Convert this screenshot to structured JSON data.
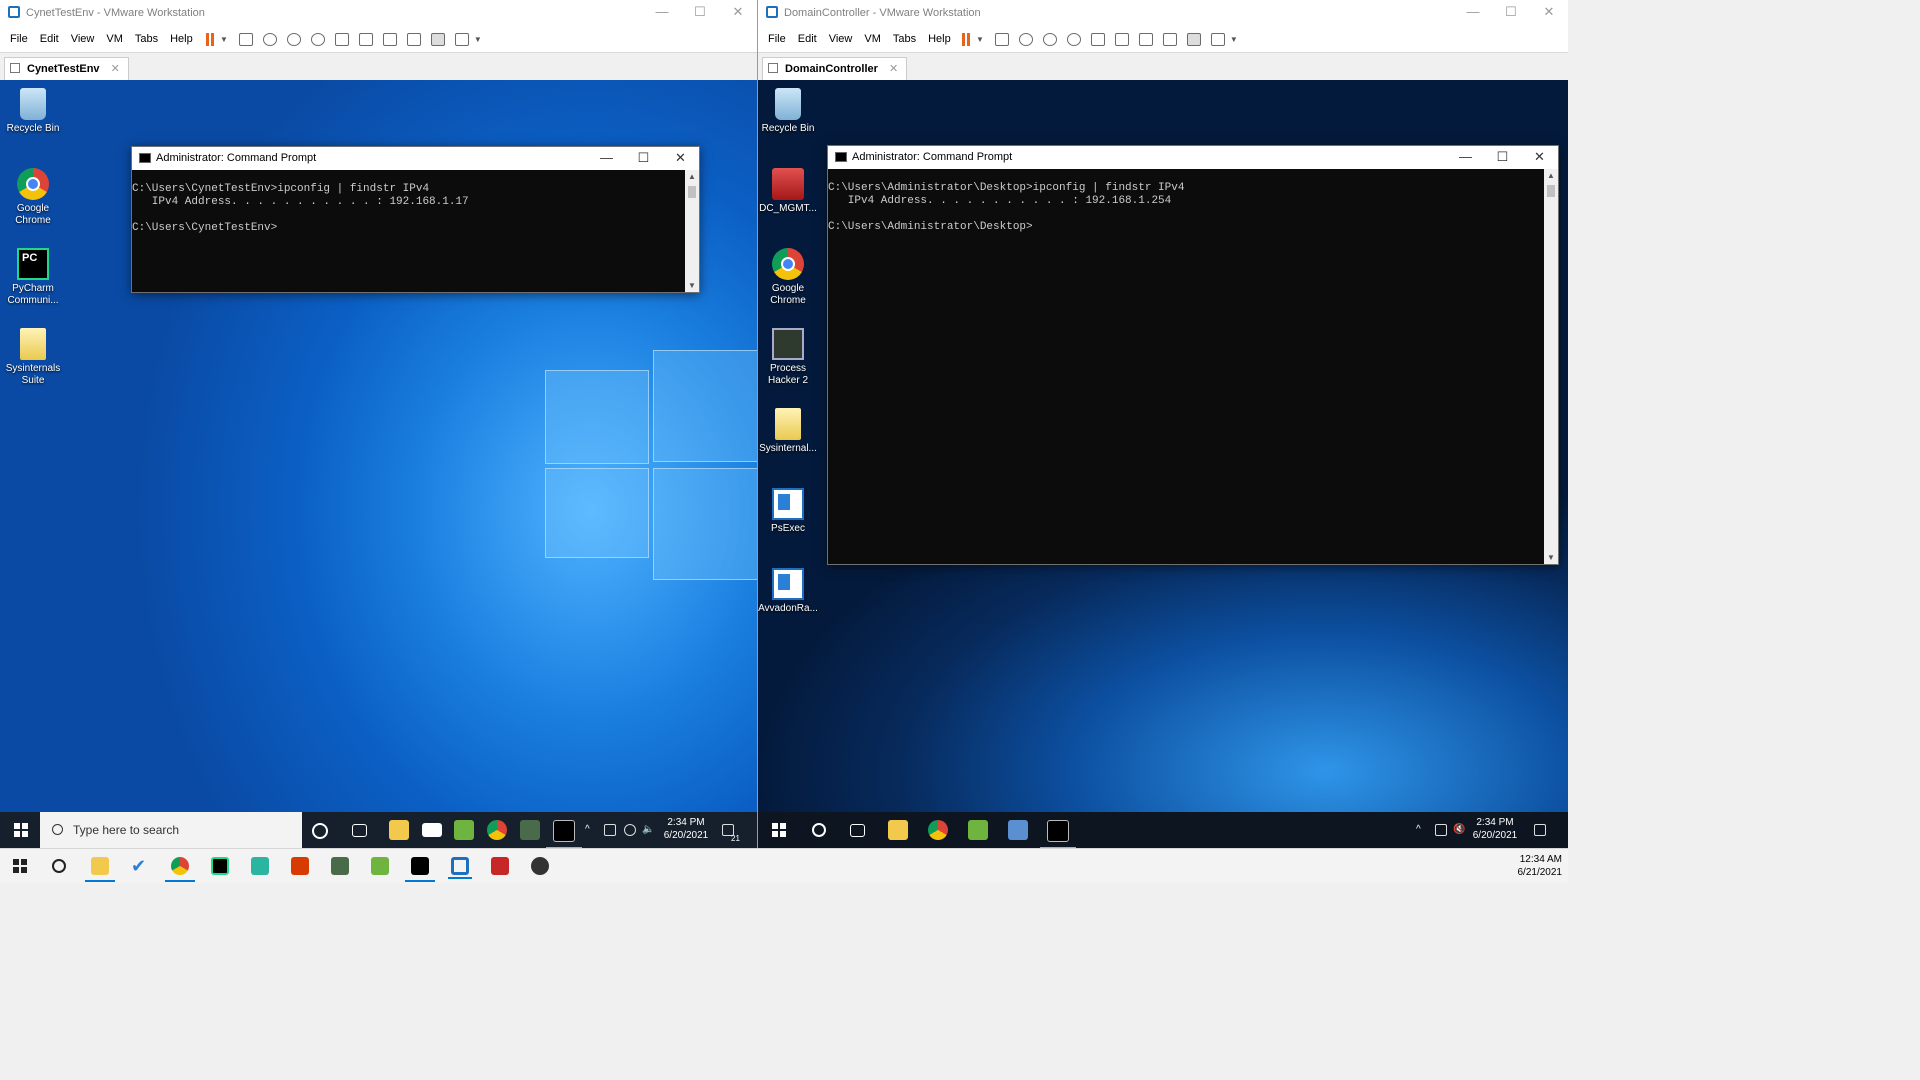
{
  "colors": {
    "accent": "#0078d4",
    "vm_pause": "#e8641b"
  },
  "vm_left": {
    "window_title": "CynetTestEnv - VMware Workstation",
    "menu": [
      "File",
      "Edit",
      "View",
      "VM",
      "Tabs",
      "Help"
    ],
    "tab_label": "CynetTestEnv",
    "desktop_icons": [
      {
        "label": "Recycle Bin",
        "icon": "recycle-bin-icon"
      },
      {
        "label": "Google Chrome",
        "icon": "chrome-icon"
      },
      {
        "label": "PyCharm Communi...",
        "icon": "pycharm-icon"
      },
      {
        "label": "Sysinternals Suite",
        "icon": "folder-icon"
      }
    ],
    "cmd": {
      "title": "Administrator: Command Prompt",
      "lines": [
        "C:\\Users\\CynetTestEnv>ipconfig | findstr IPv4",
        "   IPv4 Address. . . . . . . . . . . : 192.168.1.17",
        "",
        "C:\\Users\\CynetTestEnv>"
      ]
    },
    "taskbar": {
      "search_placeholder": "Type here to search",
      "time": "2:34 PM",
      "date": "6/20/2021",
      "notification_count": "21"
    }
  },
  "vm_right": {
    "window_title": "DomainController - VMware Workstation",
    "menu": [
      "File",
      "Edit",
      "View",
      "VM",
      "Tabs",
      "Help"
    ],
    "tab_label": "DomainController",
    "desktop_icons": [
      {
        "label": "Recycle Bin",
        "icon": "recycle-bin-icon"
      },
      {
        "label": "DC_MGMT...",
        "icon": "toolbox-icon"
      },
      {
        "label": "Google Chrome",
        "icon": "chrome-icon"
      },
      {
        "label": "Process Hacker 2",
        "icon": "process-hacker-icon"
      },
      {
        "label": "Sysinternal...",
        "icon": "folder-icon"
      },
      {
        "label": "PsExec",
        "icon": "app-window-icon"
      },
      {
        "label": "AvvadonRa...",
        "icon": "app-window-icon"
      }
    ],
    "cmd": {
      "title": "Administrator: Command Prompt",
      "lines": [
        "C:\\Users\\Administrator\\Desktop>ipconfig | findstr IPv4",
        "   IPv4 Address. . . . . . . . . . . : 192.168.1.254",
        "",
        "C:\\Users\\Administrator\\Desktop>"
      ]
    },
    "taskbar": {
      "time": "2:34 PM",
      "date": "6/20/2021"
    }
  },
  "host_taskbar": {
    "time": "12:34 AM",
    "date": "6/21/2021"
  }
}
